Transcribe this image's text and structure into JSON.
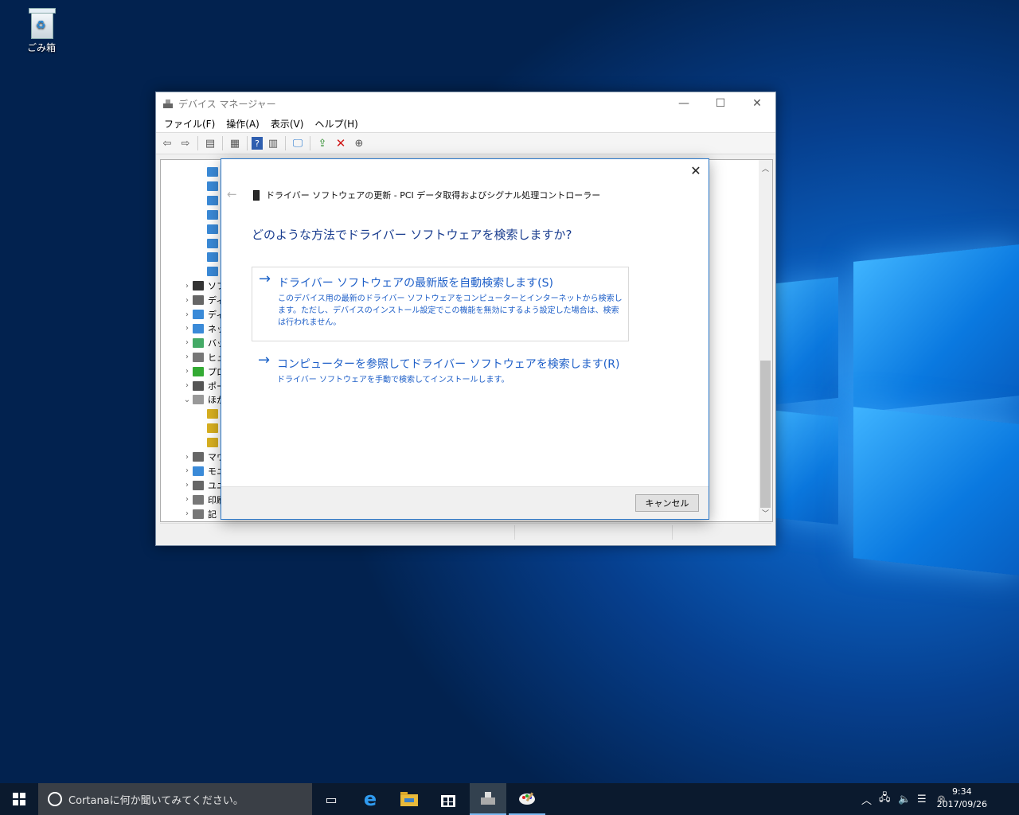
{
  "desktop": {
    "recycle_bin_label": "ごみ箱"
  },
  "device_manager": {
    "title": "デバイス マネージャー",
    "menu": [
      "ファイル(F)",
      "操作(A)",
      "表示(V)",
      "ヘルプ(H)"
    ],
    "tree_items": [
      {
        "label": ""
      },
      {
        "label": ""
      },
      {
        "label": ""
      },
      {
        "label": ""
      },
      {
        "label": ""
      },
      {
        "label": ""
      },
      {
        "label": ""
      },
      {
        "label": ""
      },
      {
        "label": "ソフ"
      },
      {
        "label": "ディ"
      },
      {
        "label": "ディ"
      },
      {
        "label": "ネッ"
      },
      {
        "label": "バッ"
      },
      {
        "label": "ヒュ"
      },
      {
        "label": "プロ"
      },
      {
        "label": "ポー"
      },
      {
        "label": "ほか"
      },
      {
        "label": ""
      },
      {
        "label": ""
      },
      {
        "label": ""
      },
      {
        "label": "マウ"
      },
      {
        "label": "モニ"
      },
      {
        "label": "ユニ"
      },
      {
        "label": "印刷"
      },
      {
        "label": "記"
      }
    ]
  },
  "dialog": {
    "header": "ドライバー ソフトウェアの更新 - PCI データ取得およびシグナル処理コントローラー",
    "question": "どのような方法でドライバー ソフトウェアを検索しますか?",
    "option1": {
      "title": "ドライバー ソフトウェアの最新版を自動検索します(S)",
      "desc": "このデバイス用の最新のドライバー ソフトウェアをコンピューターとインターネットから検索します。ただし、デバイスのインストール設定でこの機能を無効にするよう設定した場合は、検索は行われません。"
    },
    "option2": {
      "title": "コンピューターを参照してドライバー ソフトウェアを検索します(R)",
      "desc": "ドライバー ソフトウェアを手動で検索してインストールします。"
    },
    "cancel_label": "キャンセル"
  },
  "taskbar": {
    "search_placeholder": "Cortanaに何か聞いてみてください。",
    "time": "9:34",
    "date": "2017/09/26"
  }
}
